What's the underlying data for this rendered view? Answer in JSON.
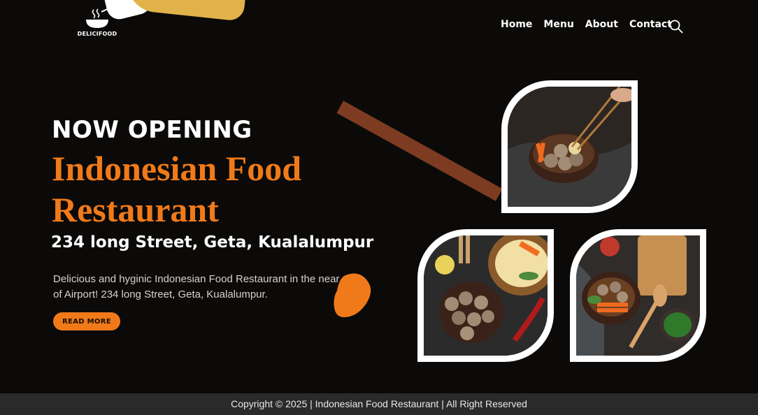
{
  "brand": {
    "logo_text": "DELICIFOOD"
  },
  "nav": {
    "items": [
      {
        "label": "Home"
      },
      {
        "label": "Menu"
      },
      {
        "label": "About"
      },
      {
        "label": "Contact"
      }
    ]
  },
  "hero": {
    "kicker": "NOW OPENING",
    "title": "Indonesian Food Restaurant",
    "address": "234 long Street, Geta, Kualalumpur",
    "description": "Delicious and hyginic Indonesian Food Restaurant in the near of Airport! 234 long Street, Geta, Kualalumpur.",
    "cta_label": "READ MORE"
  },
  "footer": {
    "copyright": "Copyright © 2025 | Indonesian Food Restaurant | All Right Reserved"
  },
  "colors": {
    "background": "#0b0a08",
    "accent": "#f07a1a",
    "stick": "#7d3c22",
    "footer": "#2a2a2a",
    "deco_yellow": "#e2b24a"
  },
  "icons": {
    "logo": "bowl-icon",
    "search": "search-icon"
  },
  "images": [
    {
      "name": "meatball-bowl-chopsticks-image"
    },
    {
      "name": "meatballs-noodles-image"
    },
    {
      "name": "meatball-soup-table-image"
    }
  ]
}
